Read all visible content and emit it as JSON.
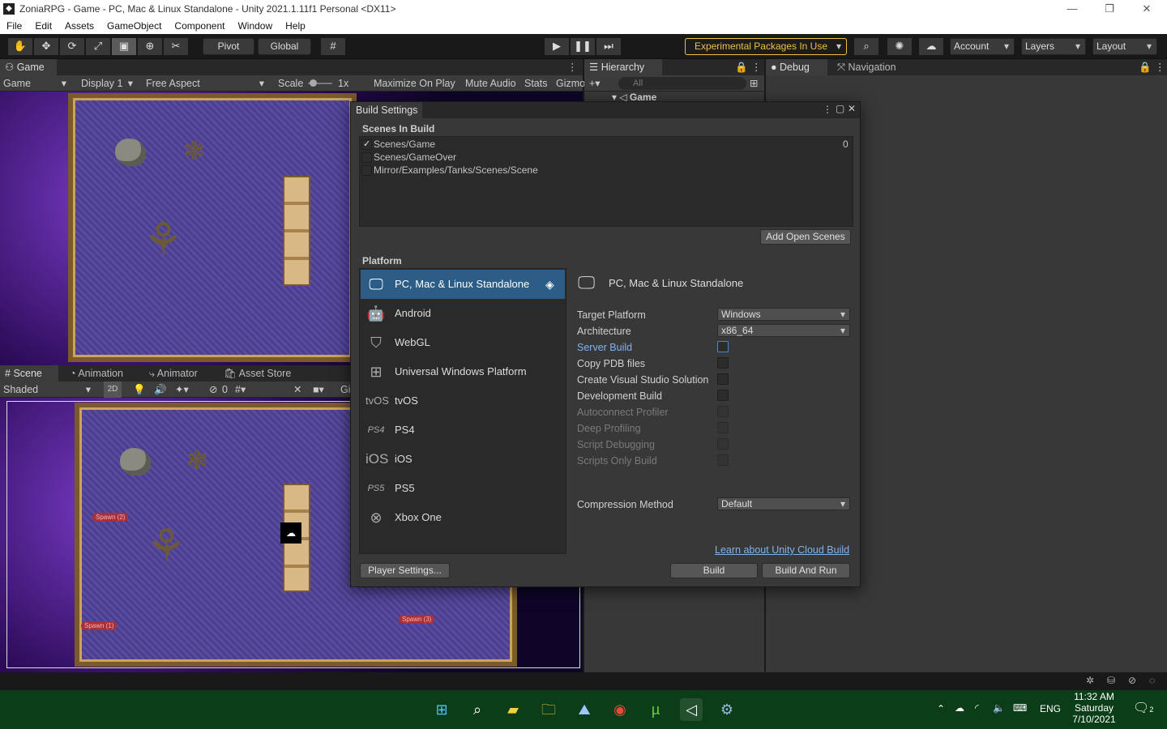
{
  "window": {
    "title": "ZoniaRPG - Game - PC, Mac & Linux Standalone - Unity 2021.1.11f1 Personal <DX11>",
    "minimize": "—",
    "maximize": "❐",
    "close": "✕"
  },
  "menu": [
    "File",
    "Edit",
    "Assets",
    "GameObject",
    "Component",
    "Window",
    "Help"
  ],
  "toolbar": {
    "pivot": "Pivot",
    "global": "Global",
    "experimental": "Experimental Packages In Use",
    "account": "Account",
    "layers": "Layers",
    "layout": "Layout",
    "accent_color": "#f0c040"
  },
  "game_panel": {
    "tab": "Game",
    "display_mode": "Game",
    "display": "Display 1",
    "aspect": "Free Aspect",
    "scale_label": "Scale",
    "scale_value": "1x",
    "maximize": "Maximize On Play",
    "mute": "Mute Audio",
    "stats": "Stats",
    "gizmos": "Gizmo"
  },
  "scene_panel": {
    "tabs": [
      "Scene",
      "Animation",
      "Animator",
      "Asset Store"
    ],
    "shading": "Shaded",
    "mode_2d": "2D",
    "hidden_count": "0",
    "gizmos": "Gi",
    "spawns": [
      "Spawn (2)",
      "Spawn (1)",
      "Spawn (3)"
    ]
  },
  "hierarchy": {
    "tab": "Hierarchy",
    "search_placeholder": "All",
    "root": "Game"
  },
  "right_panel": {
    "tabs": [
      "Debug",
      "Navigation"
    ]
  },
  "build_settings": {
    "title": "Build Settings",
    "scenes_header": "Scenes In Build",
    "scenes": [
      {
        "name": "Scenes/Game",
        "checked": true,
        "index": "0"
      },
      {
        "name": "Scenes/GameOver",
        "checked": false,
        "index": ""
      },
      {
        "name": "Mirror/Examples/Tanks/Scenes/Scene",
        "checked": false,
        "index": ""
      }
    ],
    "add_open_scenes": "Add Open Scenes",
    "platform_header": "Platform",
    "platforms": [
      {
        "name": "PC, Mac & Linux Standalone",
        "icon": "monitor-icon",
        "selected": true
      },
      {
        "name": "Android",
        "icon": "android-icon",
        "selected": false
      },
      {
        "name": "WebGL",
        "icon": "html5-icon",
        "selected": false
      },
      {
        "name": "Universal Windows Platform",
        "icon": "windows-icon",
        "selected": false
      },
      {
        "name": "tvOS",
        "icon": "tvos-icon",
        "selected": false
      },
      {
        "name": "PS4",
        "icon": "ps4-icon",
        "selected": false
      },
      {
        "name": "iOS",
        "icon": "ios-icon",
        "selected": false
      },
      {
        "name": "PS5",
        "icon": "ps5-icon",
        "selected": false
      },
      {
        "name": "Xbox One",
        "icon": "xbox-icon",
        "selected": false
      }
    ],
    "platform_icon_text": {
      "tvos": "tvOS",
      "ios": "iOS",
      "ps4": "PS4",
      "ps5": "PS5"
    },
    "selected_platform_title": "PC, Mac & Linux Standalone",
    "settings": {
      "target_platform_label": "Target Platform",
      "target_platform_value": "Windows",
      "architecture_label": "Architecture",
      "architecture_value": "x86_64",
      "server_build": "Server Build",
      "copy_pdb": "Copy PDB files",
      "create_vs": "Create Visual Studio Solution",
      "development_build": "Development Build",
      "autoconnect": "Autoconnect Profiler",
      "deep_profiling": "Deep Profiling",
      "script_debugging": "Script Debugging",
      "scripts_only": "Scripts Only Build",
      "compression_label": "Compression Method",
      "compression_value": "Default"
    },
    "learn_link": "Learn about Unity Cloud Build",
    "player_settings": "Player Settings...",
    "build": "Build",
    "build_and_run": "Build And Run"
  },
  "taskbar": {
    "language": "ENG",
    "time": "11:32 AM",
    "day": "Saturday",
    "date": "7/10/2021",
    "notification_count": "2"
  }
}
